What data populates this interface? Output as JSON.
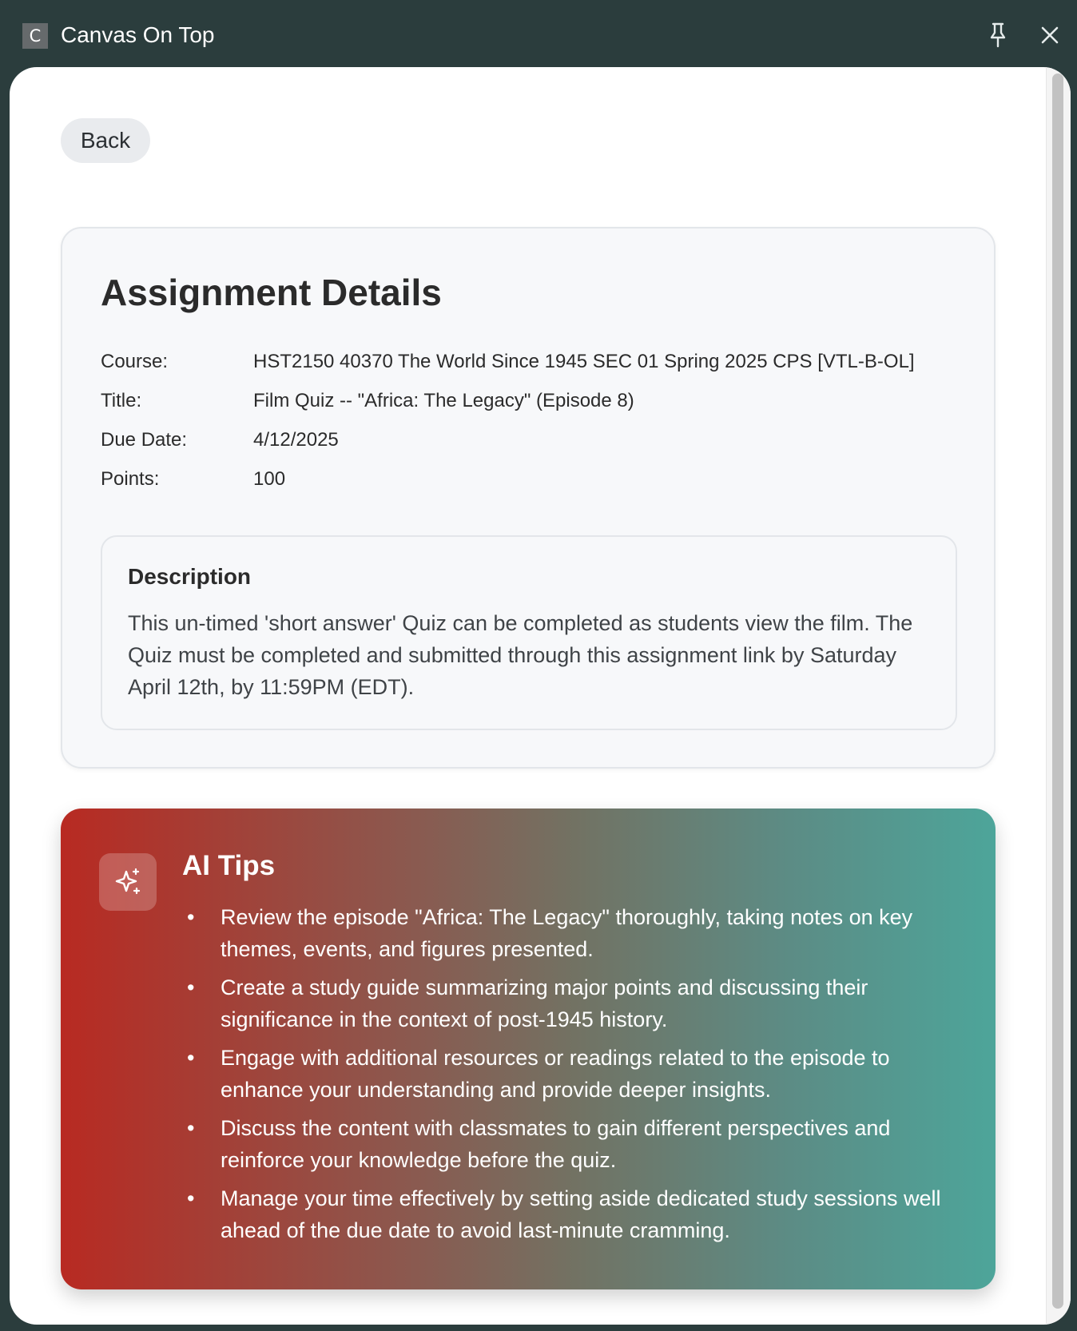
{
  "window": {
    "app_icon_letter": "C",
    "title": "Canvas On Top",
    "pin_icon": "pin-icon",
    "close_icon": "close-icon"
  },
  "nav": {
    "back_label": "Back"
  },
  "assignment": {
    "heading": "Assignment Details",
    "fields": [
      {
        "label": "Course:",
        "value": "HST2150 40370 The World Since 1945 SEC 01 Spring 2025 CPS [VTL-B-OL]"
      },
      {
        "label": "Title:",
        "value": "Film Quiz -- \"Africa: The Legacy\" (Episode 8)"
      },
      {
        "label": "Due Date:",
        "value": "4/12/2025"
      },
      {
        "label": "Points:",
        "value": "100"
      }
    ],
    "description": {
      "heading": "Description",
      "text": "This un-timed 'short answer' Quiz can be completed as students view the film. The Quiz must be completed and submitted through this assignment link by Saturday April 12th, by 11:59PM (EDT)."
    }
  },
  "ai_tips": {
    "icon": "sparkles-icon",
    "heading": "AI Tips",
    "bullet": "•",
    "items": [
      "Review the episode \"Africa: The Legacy\" thoroughly, taking notes on key themes, events, and figures presented.",
      "Create a study guide summarizing major points and discussing their significance in the context of post-1945 history.",
      "Engage with additional resources or readings related to the episode to enhance your understanding and provide deeper insights.",
      "Discuss the content with classmates to gain different perspectives and reinforce your knowledge before the quiz.",
      "Manage your time effectively by setting aside dedicated study sessions well ahead of the due date to avoid last-minute cramming."
    ]
  },
  "colors": {
    "title_bar": "#2b3d3d",
    "gradient_start": "#b82a22",
    "gradient_end": "#4da59a",
    "card_background": "#f7f8fa"
  }
}
